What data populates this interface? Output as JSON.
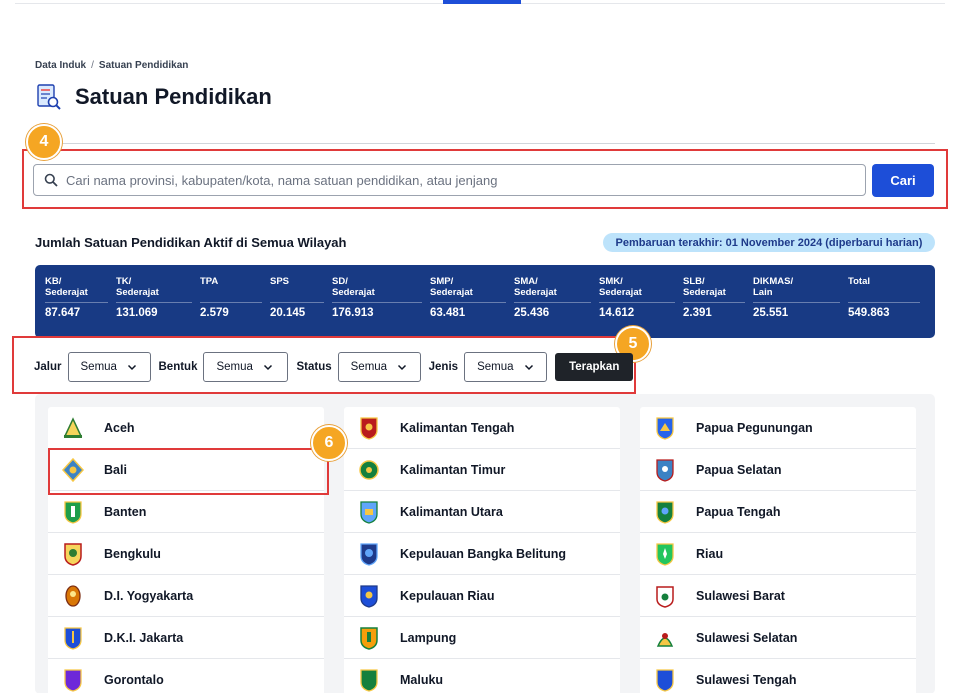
{
  "breadcrumb": {
    "parent": "Data Induk",
    "separator": "/",
    "current": "Satuan Pendidikan"
  },
  "page": {
    "title": "Satuan Pendidikan"
  },
  "search": {
    "placeholder": "Cari nama provinsi, kabupaten/kota, nama satuan pendidikan, atau jenjang",
    "value": "",
    "button_label": "Cari",
    "icon": "search-icon"
  },
  "annotations": {
    "search": "4",
    "filters": "5",
    "bali": "6"
  },
  "summary": {
    "title": "Jumlah Satuan Pendidikan Aktif di Semua Wilayah",
    "update_note": "Pembaruan terakhir: 01 November 2024 (diperbarui harian)"
  },
  "stats": [
    {
      "label": "KB/\nSederajat",
      "value": "87.647"
    },
    {
      "label": "TK/\nSederajat",
      "value": "131.069"
    },
    {
      "label": "TPA",
      "value": "2.579"
    },
    {
      "label": "SPS",
      "value": "20.145"
    },
    {
      "label": "SD/\nSederajat",
      "value": "176.913"
    },
    {
      "label": "SMP/\nSederajat",
      "value": "63.481"
    },
    {
      "label": "SMA/\nSederajat",
      "value": "25.436"
    },
    {
      "label": "SMK/\nSederajat",
      "value": "14.612"
    },
    {
      "label": "SLB/\nSederajat",
      "value": "2.391"
    },
    {
      "label": "DIKMAS/\nLain",
      "value": "25.551"
    },
    {
      "label": "Total",
      "value": "549.863"
    }
  ],
  "filters": {
    "jalur": {
      "label": "Jalur",
      "value": "Semua"
    },
    "bentuk": {
      "label": "Bentuk",
      "value": "Semua"
    },
    "status": {
      "label": "Status",
      "value": "Semua"
    },
    "jenis": {
      "label": "Jenis",
      "value": "Semua"
    },
    "apply_label": "Terapkan"
  },
  "provinces": {
    "col1": [
      "Aceh",
      "Bali",
      "Banten",
      "Bengkulu",
      "D.I. Yogyakarta",
      "D.K.I. Jakarta",
      "Gorontalo"
    ],
    "col2": [
      "Kalimantan Tengah",
      "Kalimantan Timur",
      "Kalimantan Utara",
      "Kepulauan Bangka Belitung",
      "Kepulauan Riau",
      "Lampung",
      "Maluku"
    ],
    "col3": [
      "Papua Pegunungan",
      "Papua Selatan",
      "Papua Tengah",
      "Riau",
      "Sulawesi Barat",
      "Sulawesi Selatan",
      "Sulawesi Tengah"
    ]
  },
  "colors": {
    "primary": "#1d4ed8",
    "stats_bg": "#183a84",
    "annotation": "#e03a3a",
    "badge": "#f5a623",
    "pill_bg": "#bde3fb"
  }
}
